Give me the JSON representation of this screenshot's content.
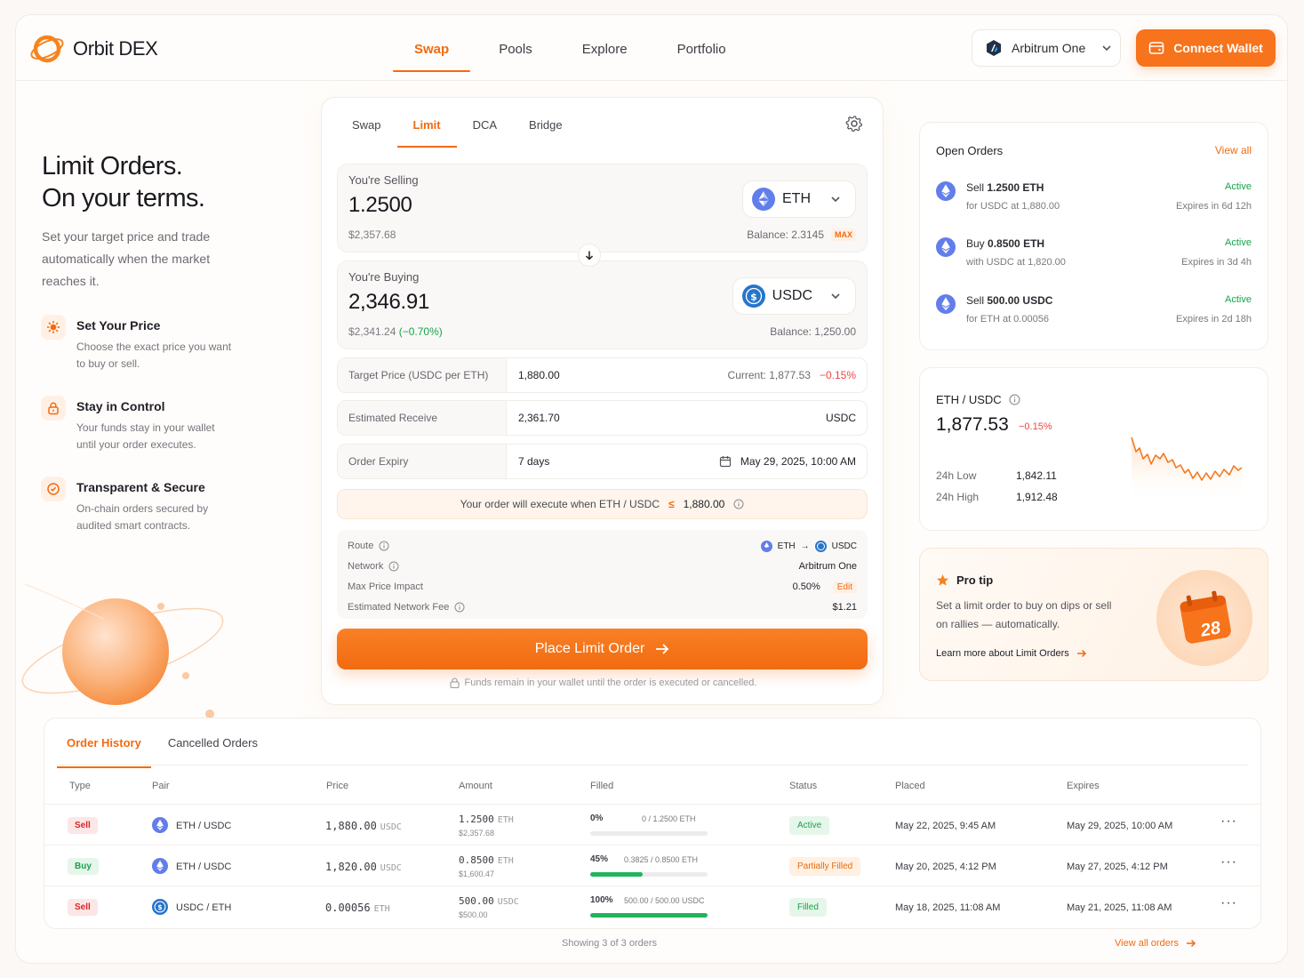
{
  "brand": {
    "name": "Orbit DEX",
    "accent": "#f26a10"
  },
  "nav": {
    "items": [
      "Swap",
      "Pools",
      "Explore",
      "Portfolio"
    ],
    "active": "Swap"
  },
  "network": {
    "label": "Arbitrum One",
    "icon": "arbitrum-icon"
  },
  "connect_label": "Connect Wallet",
  "hero": {
    "title_line1": "Limit Orders.",
    "title_line2": "On your terms.",
    "subtitle": "Set your target price and trade automatically when the market reaches it.",
    "features": [
      {
        "icon": "target-icon",
        "title": "Set Your Price",
        "desc": "Choose the exact price you want to buy or sell."
      },
      {
        "icon": "lock-icon",
        "title": "Stay in Control",
        "desc": "Your funds stay in your wallet until your order executes."
      },
      {
        "icon": "shield-icon",
        "title": "Transparent & Secure",
        "desc": "On-chain orders secured by audited smart contracts."
      }
    ]
  },
  "trade": {
    "tabs": [
      "Swap",
      "Limit",
      "DCA",
      "Bridge"
    ],
    "active_tab": "Limit",
    "sell": {
      "label": "You're Selling",
      "amount": "1.2500",
      "usd": "$2,357.68",
      "token": "ETH",
      "balance": "Balance: 2.3145",
      "max": "MAX"
    },
    "buy": {
      "label": "You're Buying",
      "amount": "2,346.91",
      "usd": "$2,341.24",
      "usd_change": "(−0.70%)",
      "token": "USDC",
      "balance": "Balance: 1,250.00"
    },
    "target": {
      "label": "Target Price (USDC per ETH)",
      "value": "1,880.00",
      "current": "Current: 1,877.53",
      "diff": "−0.15%"
    },
    "receive": {
      "label": "Estimated Receive",
      "value": "2,361.70",
      "unit": "USDC"
    },
    "expiry": {
      "label": "Order Expiry",
      "value": "7 days",
      "date": "May 29, 2025, 10:00 AM"
    },
    "exec_note": {
      "text": "Your order will execute when ETH / USDC",
      "op": "≤",
      "price": "1,880.00"
    },
    "details": {
      "route_label": "Route",
      "route_from": "ETH",
      "route_arrow": "→",
      "route_to": "USDC",
      "network_label": "Network",
      "network_value": "Arbitrum One",
      "impact_label": "Max Price Impact",
      "impact_value": "0.50%",
      "impact_edit": "Edit",
      "fee_label": "Estimated Network Fee",
      "fee_value": "$1.21"
    },
    "cta": "Place Limit Order",
    "funds_note": "Funds remain in your wallet until the order is executed or cancelled."
  },
  "open_orders": {
    "title": "Open Orders",
    "view_all": "View all",
    "items": [
      {
        "action": "Sell",
        "amount": "1.2500 ETH",
        "sub": "for USDC at 1,880.00",
        "status": "Active",
        "expires": "Expires in 6d 12h"
      },
      {
        "action": "Buy",
        "amount": "0.8500 ETH",
        "sub": "with USDC at 1,820.00",
        "status": "Active",
        "expires": "Expires in 3d 4h"
      },
      {
        "action": "Sell",
        "amount": "500.00 USDC",
        "sub": "for ETH at 0.00056",
        "status": "Active",
        "expires": "Expires in 2d 18h"
      }
    ]
  },
  "market": {
    "pair": "ETH / USDC",
    "price": "1,877.53",
    "change": "−0.15%",
    "low_label": "24h Low",
    "low": "1,842.11",
    "high_label": "24h High",
    "high": "1,912.48"
  },
  "pro_tip": {
    "title": "Pro tip",
    "text": "Set a limit order to buy on dips or sell on rallies — automatically.",
    "link": "Learn more about Limit Orders",
    "calendar_day": "28"
  },
  "history": {
    "tabs": [
      "Order History",
      "Cancelled Orders"
    ],
    "active_tab": "Order History",
    "columns": [
      "Type",
      "Pair",
      "Price",
      "Amount",
      "Filled",
      "Status",
      "Placed",
      "Expires"
    ],
    "rows": [
      {
        "type": "Sell",
        "pair": "ETH / USDC",
        "pair_icon": "eth",
        "price": "1,880.00",
        "price_unit": "USDC",
        "amount": "1.2500",
        "amount_unit": "ETH",
        "amount_usd": "$2,357.68",
        "filled_pct": "0%",
        "filled_detail": "0 / 1.2500 ETH",
        "filled_frac": 0,
        "status": "Active",
        "placed": "May 22, 2025, 9:45 AM",
        "expires": "May 29, 2025, 10:00 AM"
      },
      {
        "type": "Buy",
        "pair": "ETH / USDC",
        "pair_icon": "eth",
        "price": "1,820.00",
        "price_unit": "USDC",
        "amount": "0.8500",
        "amount_unit": "ETH",
        "amount_usd": "$1,600.47",
        "filled_pct": "45%",
        "filled_detail": "0.3825 / 0.8500 ETH",
        "filled_frac": 0.45,
        "status": "Partially Filled",
        "placed": "May 20, 2025, 4:12 PM",
        "expires": "May 27, 2025, 4:12 PM"
      },
      {
        "type": "Sell",
        "pair": "USDC / ETH",
        "pair_icon": "usdc",
        "price": "0.00056",
        "price_unit": "ETH",
        "amount": "500.00",
        "amount_unit": "USDC",
        "amount_usd": "$500.00",
        "filled_pct": "100%",
        "filled_detail": "500.00 / 500.00 USDC",
        "filled_frac": 1,
        "status": "Filled",
        "placed": "May 18, 2025, 11:08 AM",
        "expires": "May 21, 2025, 11:08 AM"
      }
    ],
    "footer": "Showing 3 of 3 orders",
    "view_all": "View all orders"
  }
}
